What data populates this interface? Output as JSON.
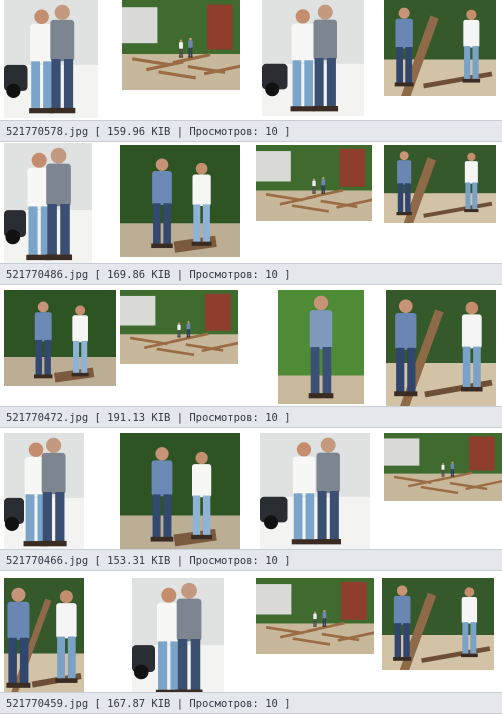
{
  "gallery": {
    "rows": [
      {
        "filename": "521770578.jpg",
        "size": "159.96 KIB",
        "views_label": "Просмотров:",
        "views": "10",
        "thumbs": [
          "couple-walking-car",
          "construction-site",
          "couple-walking-car",
          "couple-yard-lumber"
        ]
      },
      {
        "filename": "521770486.jpg",
        "size": "169.86 KIB",
        "views_label": "Просмотров:",
        "views": "10",
        "thumbs": [
          "couple-walking-car",
          "couple-standing-trees",
          "construction-site",
          "couple-yard-lumber"
        ]
      },
      {
        "filename": "521770472.jpg",
        "size": "191.13 KIB",
        "views_label": "Просмотров:",
        "views": "10",
        "thumbs": [
          "couple-standing-trees",
          "construction-site",
          "man-with-trees",
          "couple-yard-lumber"
        ]
      },
      {
        "filename": "521770466.jpg",
        "size": "153.31 KIB",
        "views_label": "Просмотров:",
        "views": "10",
        "thumbs": [
          "couple-walking-car",
          "couple-standing-trees",
          "couple-walking-car",
          "construction-site"
        ]
      },
      {
        "filename": "521770459.jpg",
        "size": "167.87 KIB",
        "views_label": "Просмотров:",
        "views": "10",
        "thumbs": [
          "couple-yard-lumber",
          "couple-walking-car",
          "construction-site",
          "couple-yard-lumber"
        ]
      }
    ]
  },
  "colors": {
    "caption_bg": "#e4e7ec",
    "caption_text": "#333a44",
    "tile_border": "#d6d8db"
  }
}
